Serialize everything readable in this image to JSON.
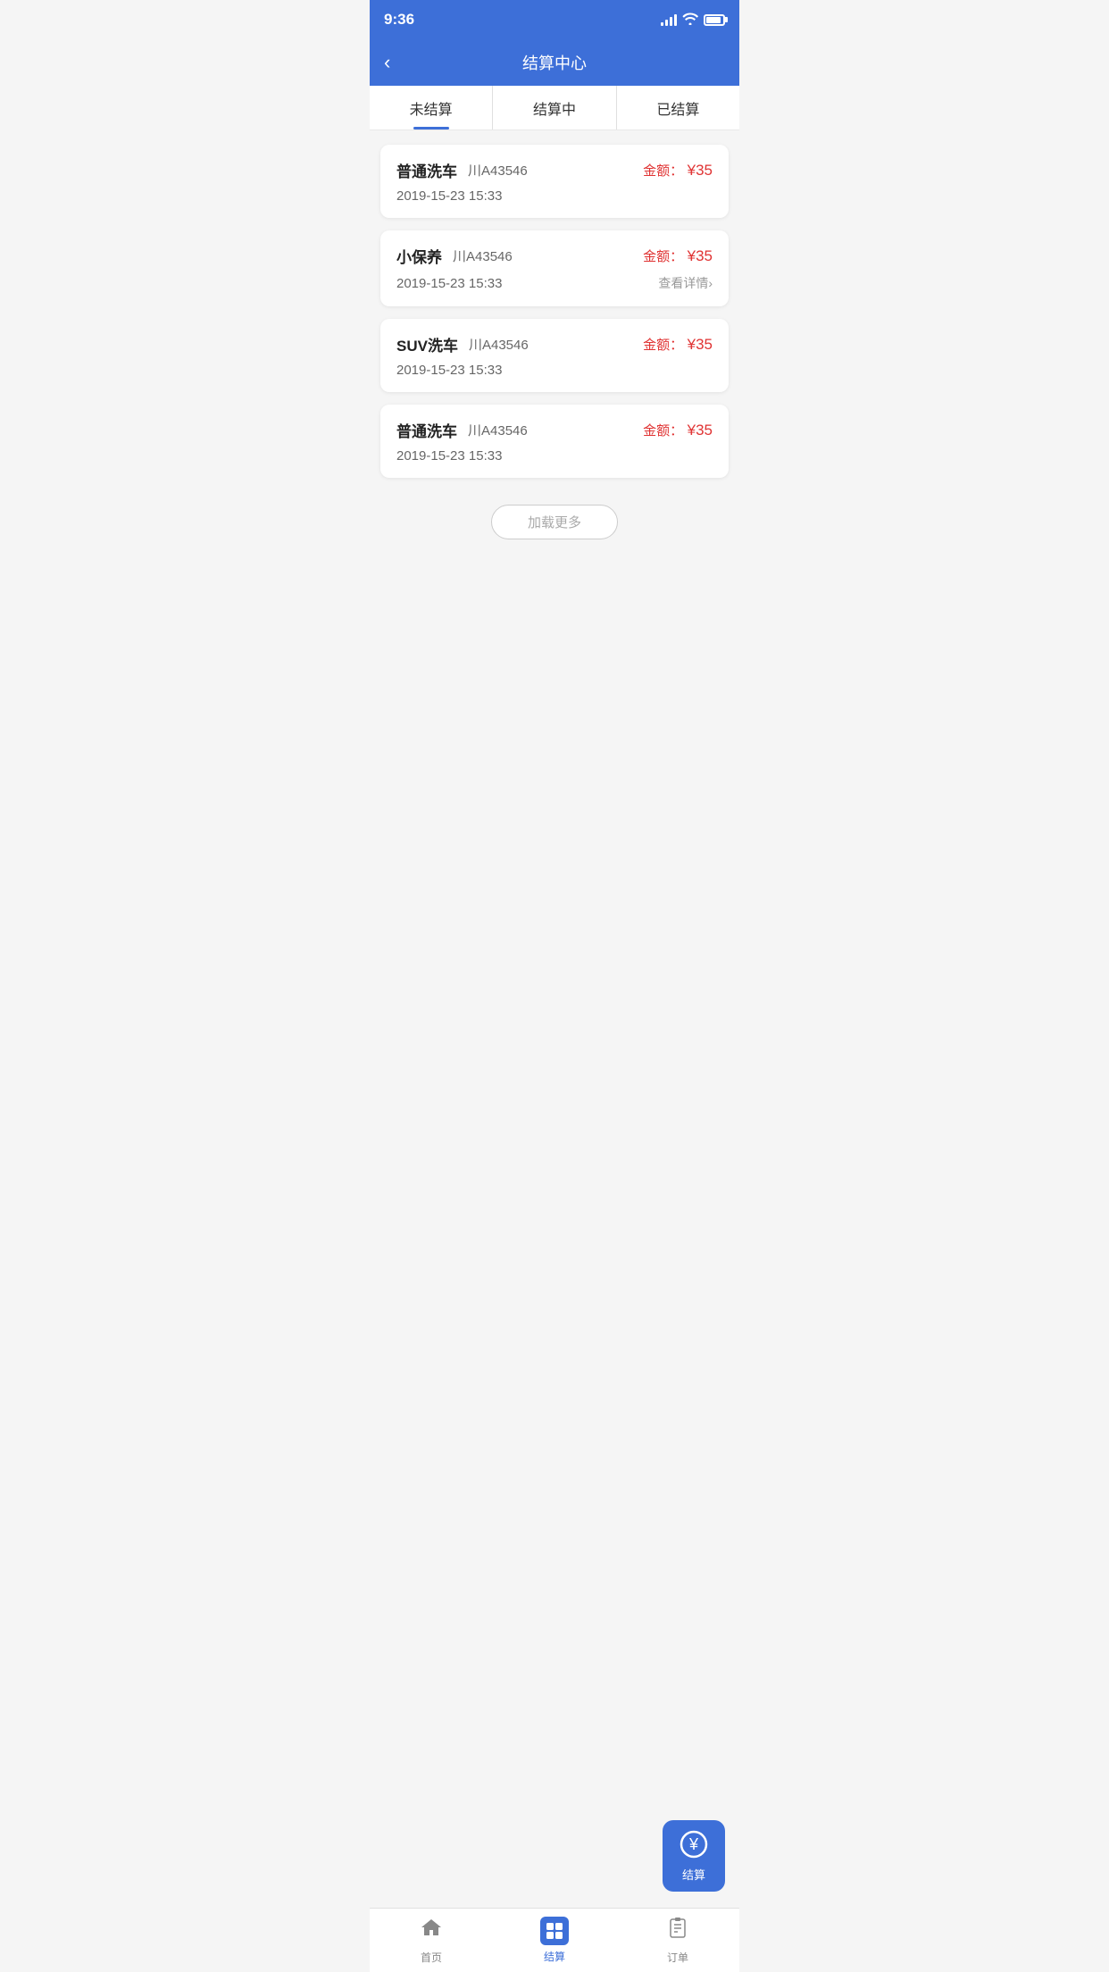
{
  "statusBar": {
    "time": "9:36"
  },
  "header": {
    "back": "‹",
    "title": "结算中心"
  },
  "tabs": [
    {
      "id": "unsettled",
      "label": "未结算",
      "active": true
    },
    {
      "id": "settling",
      "label": "结算中",
      "active": false
    },
    {
      "id": "settled",
      "label": "已结算",
      "active": false
    }
  ],
  "cards": [
    {
      "service": "普通洗车",
      "plate": "川A43546",
      "amountLabel": "金额：",
      "amount": "¥35",
      "date": "2019-15-23 15:33",
      "showDetail": false,
      "detailText": ""
    },
    {
      "service": "小保养",
      "plate": "川A43546",
      "amountLabel": "金额：",
      "amount": "¥35",
      "date": "2019-15-23 15:33",
      "showDetail": true,
      "detailText": "查看详情›"
    },
    {
      "service": "SUV洗车",
      "plate": "川A43546",
      "amountLabel": "金额：",
      "amount": "¥35",
      "date": "2019-15-23 15:33",
      "showDetail": false,
      "detailText": ""
    },
    {
      "service": "普通洗车",
      "plate": "川A43546",
      "amountLabel": "金额：",
      "amount": "¥35",
      "date": "2019-15-23 15:33",
      "showDetail": false,
      "detailText": ""
    }
  ],
  "loadMore": {
    "label": "加载更多"
  },
  "floatButton": {
    "label": "结算"
  },
  "bottomNav": [
    {
      "id": "home",
      "label": "首页",
      "active": false
    },
    {
      "id": "settlement",
      "label": "结算",
      "active": true
    },
    {
      "id": "order",
      "label": "订单",
      "active": false
    }
  ]
}
